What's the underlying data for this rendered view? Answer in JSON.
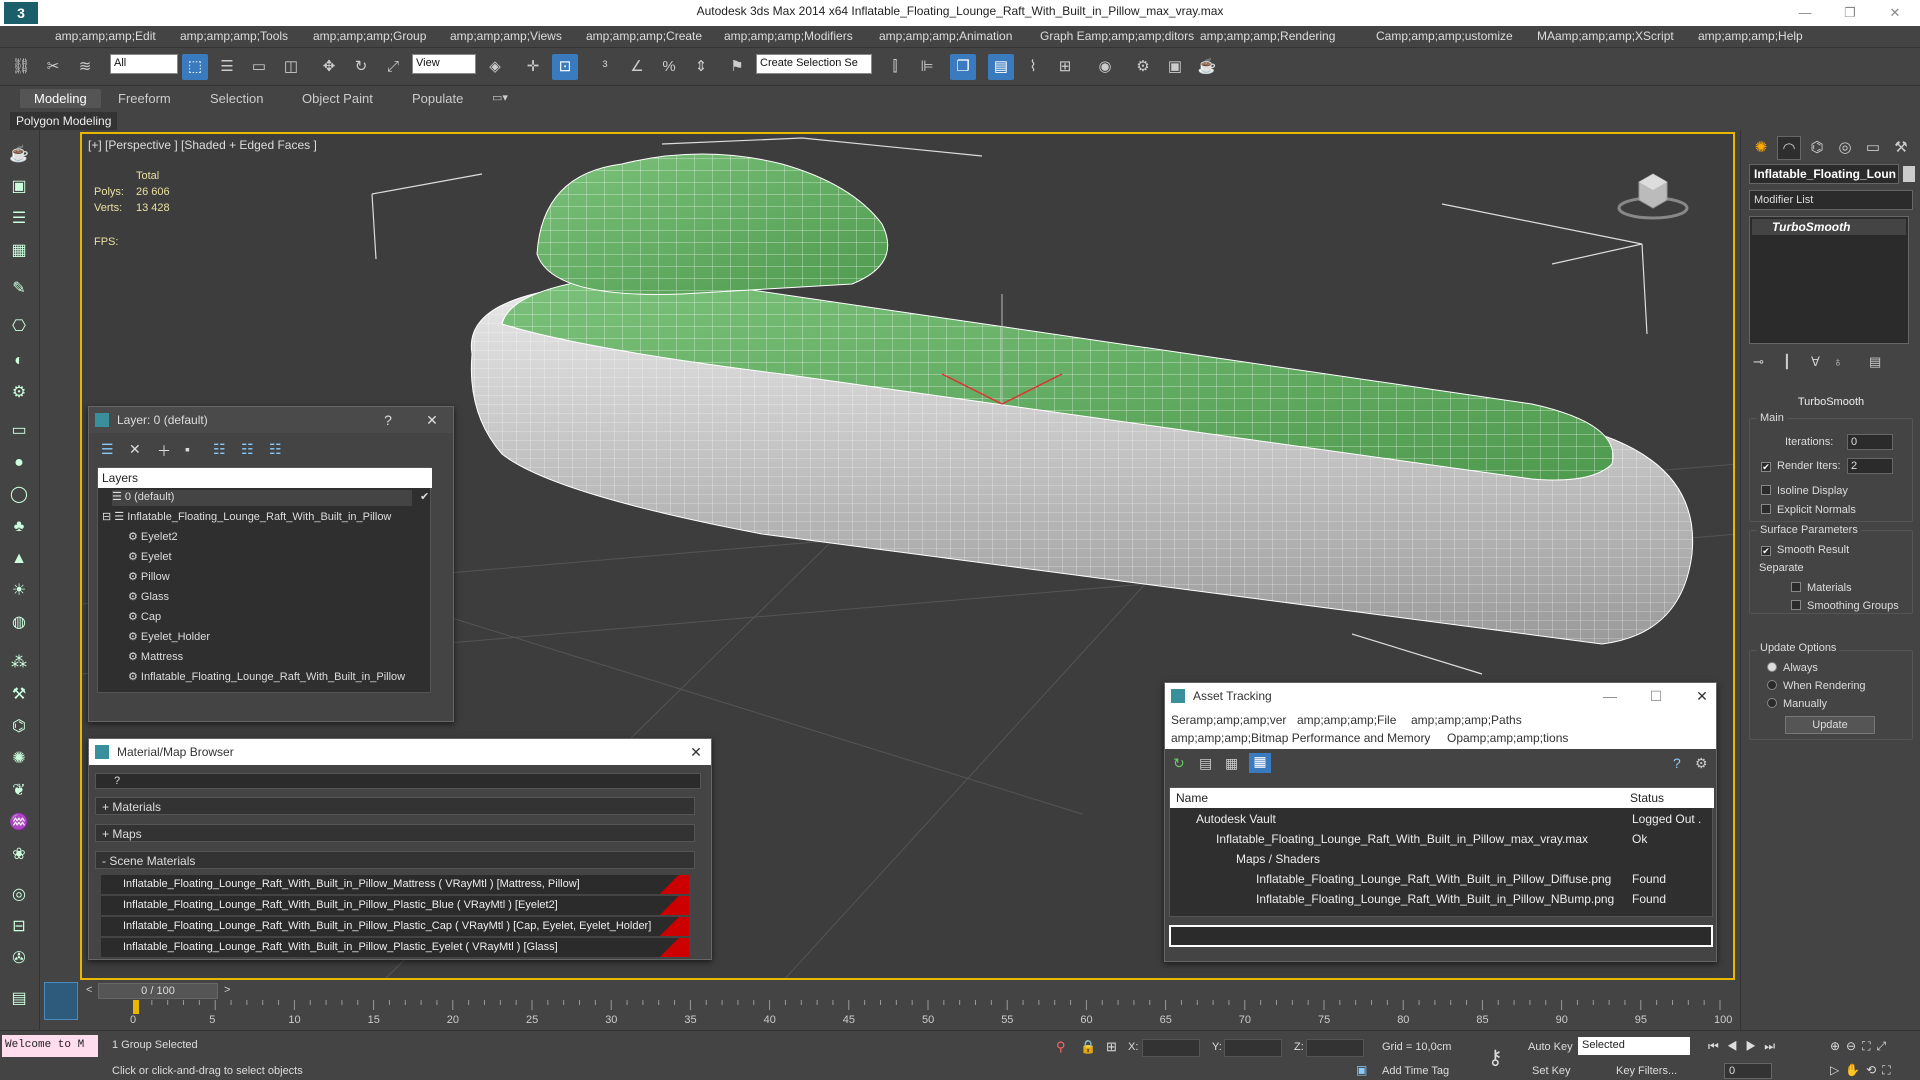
{
  "titlebar": {
    "app_title": "Autodesk 3ds Max  2014 x64     Inflatable_Floating_Lounge_Raft_With_Built_in_Pillow_max_vray.max",
    "minimize": "—",
    "maximize": "❐",
    "close": "✕"
  },
  "menu": [
    "amp;amp;amp;Edit",
    "amp;amp;amp;Tools",
    "amp;amp;amp;Group",
    "amp;amp;amp;Views",
    "amp;amp;amp;Create",
    "amp;amp;amp;Modifiers",
    "amp;amp;amp;Animation",
    "Graph Eamp;amp;amp;ditors",
    "amp;amp;amp;Rendering",
    "Camp;amp;amp;ustomize",
    "MAamp;amp;amp;XScript",
    "amp;amp;amp;Help"
  ],
  "toolbar": {
    "filter_select": "All",
    "view_select": "View",
    "selection_set": "Create Selection Se"
  },
  "ribbon": {
    "tabs": [
      "Modeling",
      "Freeform",
      "Selection",
      "Object Paint",
      "Populate"
    ],
    "sub_label": "Polygon Modeling"
  },
  "viewport": {
    "label": "[+] [Perspective ] [Shaded + Edged Faces ]",
    "stats_total": "Total",
    "polys_label": "Polys:",
    "polys_value": "26 606",
    "verts_label": "Verts:",
    "verts_value": "13 428",
    "fps_label": "FPS:"
  },
  "layer_panel": {
    "title": "Layer: 0 (default)",
    "help": "?",
    "header": "Layers",
    "rows": [
      "0 (default)",
      "Inflatable_Floating_Lounge_Raft_With_Built_in_Pillow",
      "Eyelet2",
      "Eyelet",
      "Pillow",
      "Glass",
      "Cap",
      "Eyelet_Holder",
      "Mattress",
      "Inflatable_Floating_Lounge_Raft_With_Built_in_Pillow"
    ]
  },
  "material_browser": {
    "title": "Material/Map Browser",
    "search_value": "?",
    "categories": [
      "+ Materials",
      "+ Maps",
      "- Scene Materials"
    ],
    "materials": [
      "Inflatable_Floating_Lounge_Raft_With_Built_in_Pillow_Mattress ( VRayMtl ) [Mattress, Pillow]",
      "Inflatable_Floating_Lounge_Raft_With_Built_in_Pillow_Plastic_Blue ( VRayMtl ) [Eyelet2]",
      "Inflatable_Floating_Lounge_Raft_With_Built_in_Pillow_Plastic_Cap ( VRayMtl ) [Cap, Eyelet, Eyelet_Holder]",
      "Inflatable_Floating_Lounge_Raft_With_Built_in_Pillow_Plastic_Eyelet ( VRayMtl ) [Glass]"
    ]
  },
  "asset_tracking": {
    "title": "Asset Tracking",
    "menu1": [
      "Seramp;amp;amp;ver",
      "amp;amp;amp;File",
      "amp;amp;amp;Paths"
    ],
    "menu2": [
      "amp;amp;amp;Bitmap Performance and Memory",
      "Opamp;amp;amp;tions"
    ],
    "col_name": "Name",
    "col_status": "Status",
    "rows": [
      {
        "name": "Autodesk Vault",
        "status": "Logged Out ."
      },
      {
        "name": "Inflatable_Floating_Lounge_Raft_With_Built_in_Pillow_max_vray.max",
        "status": "Ok"
      },
      {
        "name": "Maps / Shaders",
        "status": ""
      },
      {
        "name": "Inflatable_Floating_Lounge_Raft_With_Built_in_Pillow_Diffuse.png",
        "status": "Found"
      },
      {
        "name": "Inflatable_Floating_Lounge_Raft_With_Built_in_Pillow_NBump.png",
        "status": "Found"
      }
    ]
  },
  "command_panel": {
    "object_name": "Inflatable_Floating_Loun",
    "modifier_list": "Modifier List",
    "stack_item": "TurboSmooth",
    "rollout_title": "TurboSmooth",
    "main_label": "Main",
    "iterations_label": "Iterations:",
    "iterations_value": "0",
    "render_iters_label": "Render Iters:",
    "render_iters_value": "2",
    "isoline": "Isoline Display",
    "explicit_normals": "Explicit Normals",
    "surface_params": "Surface Parameters",
    "smooth_result": "Smooth Result",
    "separate": "Separate",
    "materials": "Materials",
    "smoothing_groups": "Smoothing Groups",
    "update_options": "Update Options",
    "always": "Always",
    "when_rendering": "When Rendering",
    "manually": "Manually",
    "update_button": "Update"
  },
  "timeslider": {
    "value": "0 / 100"
  },
  "timeline_ticks": [
    "0",
    "5",
    "10",
    "15",
    "20",
    "25",
    "30",
    "35",
    "40",
    "45",
    "50",
    "55",
    "60",
    "65",
    "70",
    "75",
    "80",
    "85",
    "90",
    "95",
    "100"
  ],
  "status": {
    "welcome": "Welcome to M",
    "selection": "1 Group Selected",
    "prompt": "Click or click-and-drag to select objects",
    "x_label": "X:",
    "y_label": "Y:",
    "z_label": "Z:",
    "grid": "Grid = 10,0cm",
    "add_time_tag": "Add Time Tag",
    "auto_key": "Auto Key",
    "set_key": "Set Key",
    "selected": "Selected",
    "key_filters": "Key Filters...",
    "frame": "0"
  },
  "colors": {
    "accent": "#3a7bbf",
    "viewport_border": "#e8b800",
    "mesh_green": "#5fae5f"
  }
}
